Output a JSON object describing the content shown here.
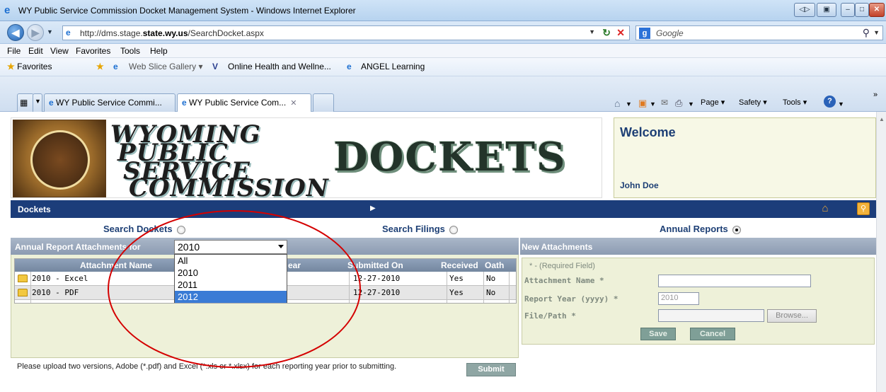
{
  "window": {
    "title": "WY Public Service Commission Docket Management System - Windows Internet Explorer"
  },
  "address": {
    "url_prefix": "http://dms.stage.",
    "url_domain": "state.wy.us",
    "url_suffix": "/SearchDocket.aspx"
  },
  "search": {
    "provider": "Google"
  },
  "menu": {
    "items": [
      "File",
      "Edit",
      "View",
      "Favorites",
      "Tools",
      "Help"
    ]
  },
  "favorites": {
    "label": "Favorites",
    "items": [
      "Web Slice Gallery ▾",
      "Online Health and Wellne...",
      "ANGEL Learning"
    ]
  },
  "tabs": [
    {
      "label": "WY Public Service Commi..."
    },
    {
      "label": "WY Public Service Com..."
    }
  ],
  "commandbar": {
    "page": "Page ▾",
    "safety": "Safety ▾",
    "tools": "Tools ▾"
  },
  "header": {
    "logo_lines": [
      "WYOMING",
      "PUBLIC",
      "SERVICE",
      "COMMISSION"
    ],
    "banner": "DOCKETS",
    "welcome": "Welcome",
    "user": "John Doe"
  },
  "nav": {
    "label": "Dockets"
  },
  "modes": {
    "search_dockets": "Search Dockets",
    "search_filings": "Search Filings",
    "annual_reports": "Annual Reports",
    "selected": "annual_reports"
  },
  "attachments": {
    "title": "Annual Report Attachments for",
    "year_selected": "2010",
    "year_options": [
      "All",
      "2010",
      "2011",
      "2012"
    ],
    "highlighted_option": "2012",
    "columns": [
      "Attachment Name",
      "ear",
      "Submitted On",
      "Received",
      "Oath"
    ],
    "rows": [
      {
        "name": "2010 - Excel",
        "submitted": "12-27-2010",
        "received": "Yes",
        "oath": "No"
      },
      {
        "name": "2010 - PDF",
        "submitted": "12-27-2010",
        "received": "Yes",
        "oath": "No"
      }
    ],
    "note": "Please upload two versions, Adobe (*.pdf) and Excel (*.xls or *.xlsx) for each reporting year prior to submitting.",
    "submit_label": "Submit"
  },
  "new_attachment": {
    "title": "New Attachments",
    "required_note": "* - (Required Field)",
    "name_label": "Attachment Name  *",
    "name_value": "",
    "year_label": "Report Year (yyyy)  *",
    "year_value": "2010",
    "file_label": "File/Path  *",
    "browse_label": "Browse...",
    "save_label": "Save",
    "cancel_label": "Cancel"
  },
  "colors": {
    "nav_blue": "#1c3d7a",
    "heading_blue": "#1d3f75",
    "panel_bg": "#eef1d9",
    "annotation_red": "#d40000"
  }
}
